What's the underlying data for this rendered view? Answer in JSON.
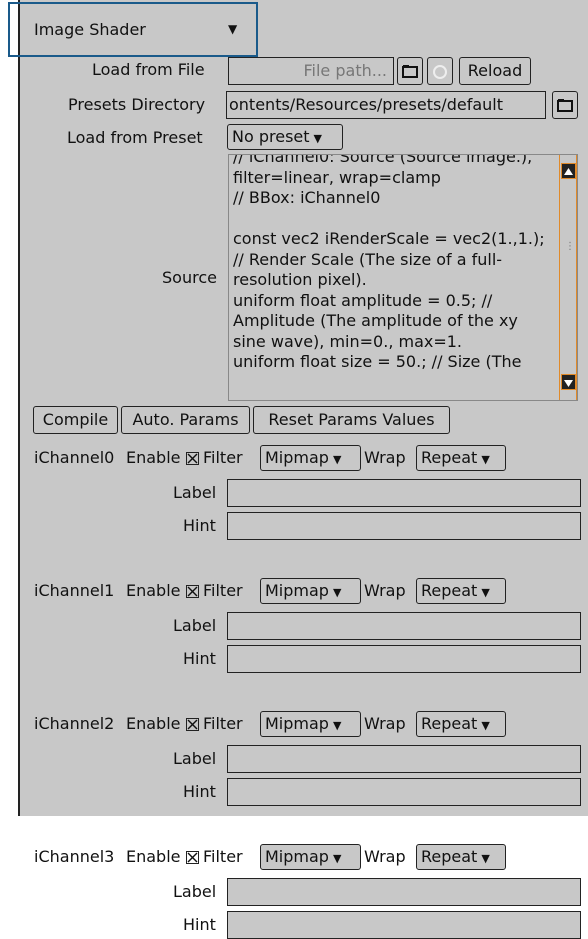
{
  "header": {
    "title": "Image Shader",
    "toggle_icon": "triangle-down-icon"
  },
  "load_file": {
    "label": "Load from File",
    "placeholder": "File path...",
    "reload": "Reload"
  },
  "presets_dir": {
    "label": "Presets Directory",
    "value": "ontents/Resources/presets/default"
  },
  "load_preset": {
    "label": "Load from Preset",
    "value": "No preset"
  },
  "source": {
    "label": "Source",
    "text": "// iChannel0: Source (Source image.), filter=linear, wrap=clamp\n// BBox: iChannel0\n\nconst vec2 iRenderScale = vec2(1.,1.); // Render Scale (The size of a full-resolution pixel).\nuniform float amplitude = 0.5; // Amplitude (The amplitude of the xy sine wave), min=0., max=1.\nuniform float size = 50.; // Size (The"
  },
  "actions": {
    "compile": "Compile",
    "auto_params": "Auto. Params",
    "reset": "Reset Params Values"
  },
  "common": {
    "enable": "Enable",
    "filter": "Filter",
    "wrap": "Wrap",
    "label": "Label",
    "hint": "Hint",
    "filter_value": "Mipmap",
    "wrap_value": "Repeat"
  },
  "channels": [
    {
      "name": "iChannel0"
    },
    {
      "name": "iChannel1"
    },
    {
      "name": "iChannel2"
    },
    {
      "name": "iChannel3"
    }
  ],
  "colors": {
    "panel": "#c8c8c8",
    "scroll_accent": "#e08a2a",
    "highlight": "#1a5a8a"
  }
}
